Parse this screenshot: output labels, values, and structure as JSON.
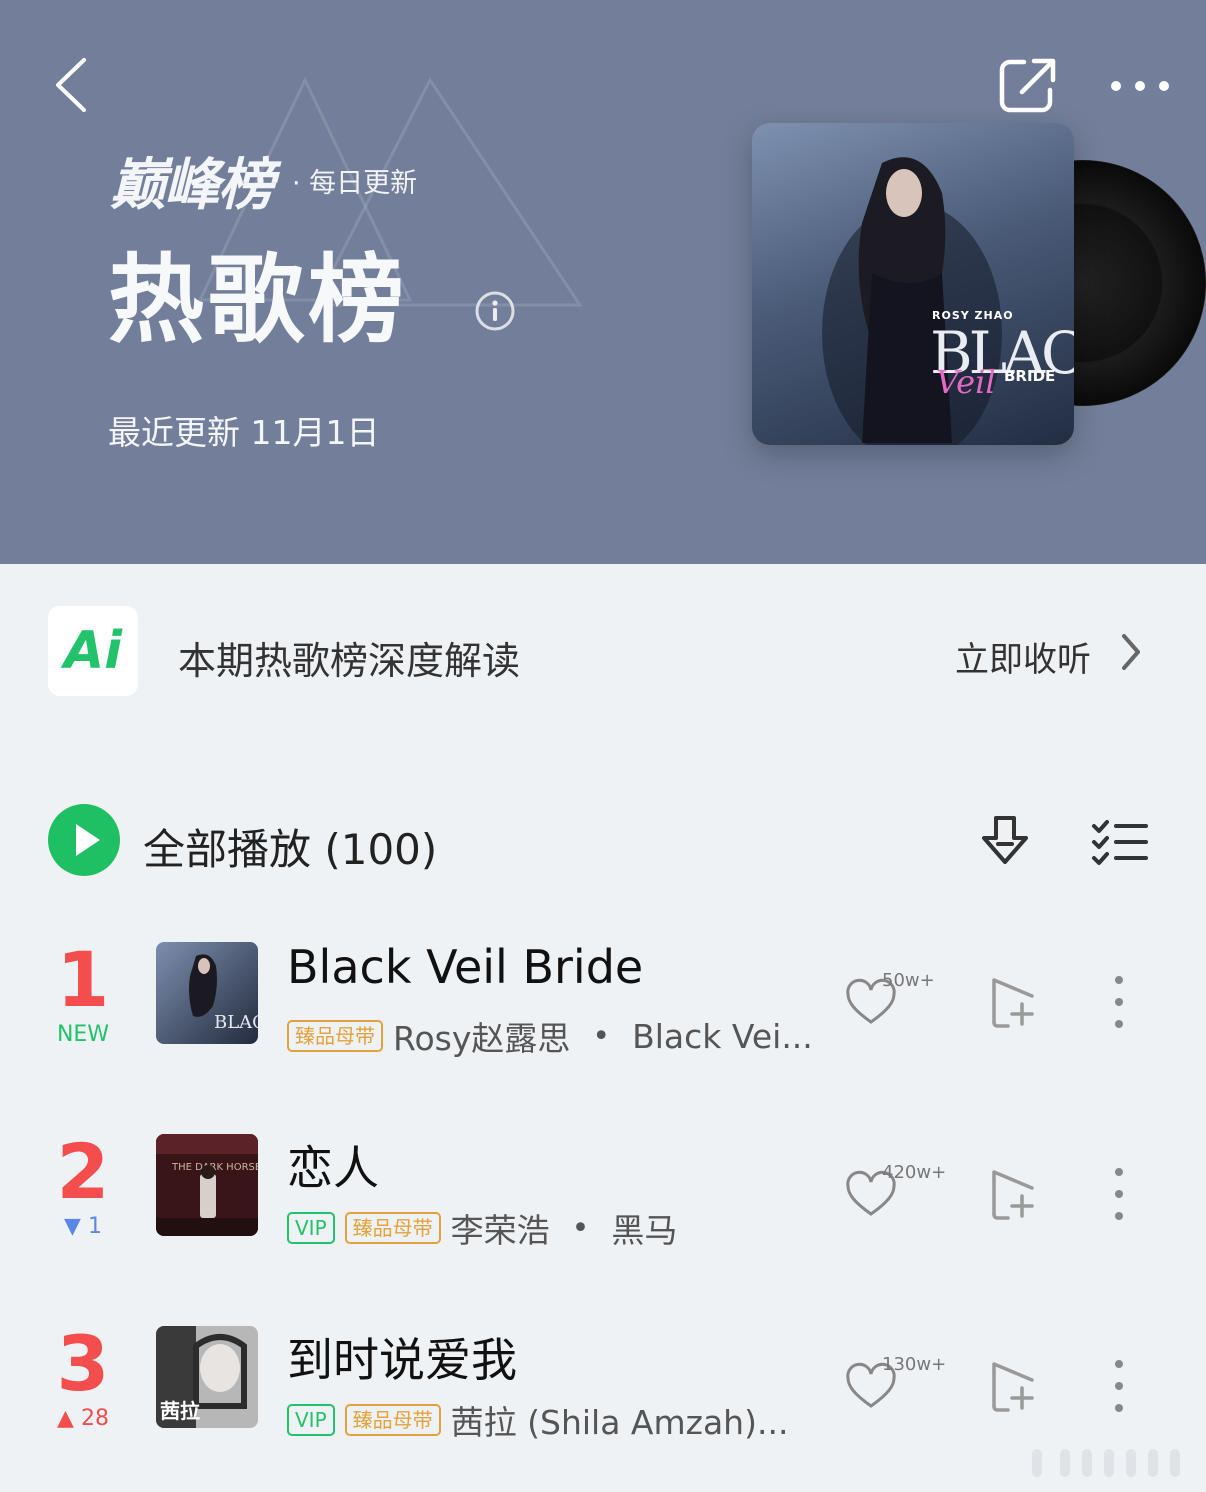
{
  "header": {
    "brand": "巅峰榜",
    "brand_sub": "· 每日更新",
    "title": "热歌榜",
    "updated": "最近更新 11月1日",
    "cover": {
      "artist_text": "ROSY ZHAO",
      "title_big": "BLACK",
      "title_script": "Veil",
      "title_small": "BRIDE"
    },
    "bg_color": "#737f9a"
  },
  "ai_banner": {
    "logo_text": "Ai",
    "text": "本期热歌榜深度解读",
    "action": "立即收听"
  },
  "toolbar": {
    "play_all": "全部播放 (100)",
    "accent": "#1fbf63"
  },
  "songs": [
    {
      "rank": "1",
      "change": "NEW",
      "title": "Black Veil Bride",
      "tags": [
        "臻品母带"
      ],
      "artist": "Rosy赵露思",
      "album": "Black Vei...",
      "likes": "50w+"
    },
    {
      "rank": "2",
      "change": "▼ 1",
      "title": "恋人",
      "tags": [
        "VIP",
        "臻品母带"
      ],
      "artist": "李荣浩",
      "album": "黑马",
      "likes": "420w+"
    },
    {
      "rank": "3",
      "change": "▲ 28",
      "title": "到时说爱我",
      "tags": [
        "VIP",
        "臻品母带"
      ],
      "artist": "茜拉 (Shila Amzah)...",
      "album": "",
      "likes": "130w+"
    }
  ]
}
